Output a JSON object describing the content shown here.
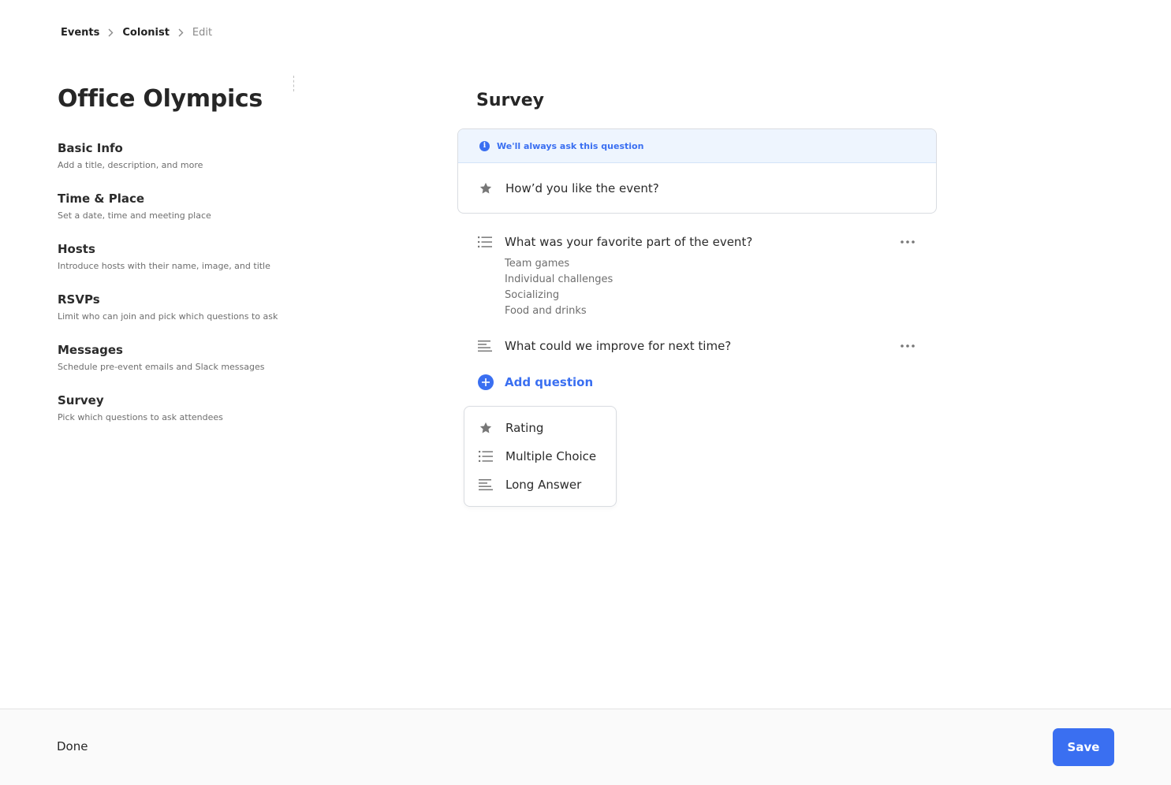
{
  "breadcrumb": {
    "items": [
      "Events",
      "Colonist",
      "Edit"
    ]
  },
  "page_title": "Office Olympics",
  "nav": {
    "items": [
      {
        "label": "Basic Info",
        "desc": "Add a title, description, and more"
      },
      {
        "label": "Time & Place",
        "desc": "Set a date, time and meeting place"
      },
      {
        "label": "Hosts",
        "desc": "Introduce hosts with their name, image, and title"
      },
      {
        "label": "RSVPs",
        "desc": "Limit who can join and pick which questions to ask"
      },
      {
        "label": "Messages",
        "desc": "Schedule pre-event emails and Slack messages"
      },
      {
        "label": "Survey",
        "desc": "Pick which questions to ask attendees"
      }
    ]
  },
  "survey": {
    "title": "Survey",
    "fixed": {
      "banner": "We'll always ask this question",
      "question": "How’d you like the event?",
      "icon": "star-icon"
    },
    "questions": [
      {
        "text": "What was your favorite part of the event?",
        "icon": "list-icon",
        "options": [
          "Team games",
          "Individual challenges",
          "Socializing",
          "Food and drinks"
        ]
      },
      {
        "text": "What could we improve for next time?",
        "icon": "long-text-icon",
        "options": []
      }
    ],
    "add_label": "Add question",
    "type_menu": [
      {
        "label": "Rating",
        "icon": "star-icon"
      },
      {
        "label": "Multiple Choice",
        "icon": "list-icon"
      },
      {
        "label": "Long Answer",
        "icon": "long-text-icon"
      }
    ]
  },
  "footer": {
    "done_label": "Done",
    "save_label": "Save"
  },
  "colors": {
    "accent": "#3a6ff1",
    "banner_bg": "#eef5fe",
    "border": "#d9dce1"
  }
}
